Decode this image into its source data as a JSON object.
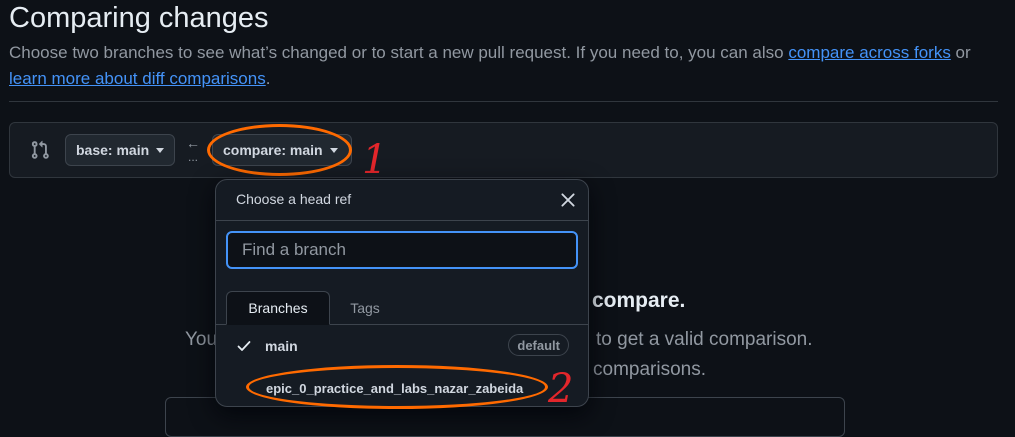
{
  "page": {
    "title": "Comparing changes",
    "description_prefix": "Choose two branches to see what’s changed or to start a new pull request. If you need to, you can also ",
    "compare_forks_link": "compare across forks",
    "description_middle": " or ",
    "learn_more_link": "learn more about diff comparisons",
    "description_suffix": "."
  },
  "range": {
    "base_label": "base: main",
    "compare_label": "compare: main",
    "arrow": "←",
    "dots": "..."
  },
  "menu": {
    "title": "Choose a head ref",
    "filter_placeholder": "Find a branch",
    "tabs": [
      {
        "label": "Branches",
        "selected": true
      },
      {
        "label": "Tags",
        "selected": false
      }
    ],
    "items": [
      {
        "label": "main",
        "badge": "default",
        "checked": true
      },
      {
        "label": "epic_0_practice_and_labs_nazar_zabeida",
        "checked": false
      }
    ]
  },
  "background": {
    "heading_fragment": "compare.",
    "line1_left": "You",
    "line1_right": "to get a valid comparison.",
    "line2_right": "comparisons."
  },
  "annotations": {
    "marker_1": "1",
    "marker_2": "2",
    "color": "#ff6a00",
    "number_color": "#e3262b"
  },
  "colors": {
    "background": "#0d1117",
    "link": "#4493f8",
    "focus": "#4493f8"
  }
}
